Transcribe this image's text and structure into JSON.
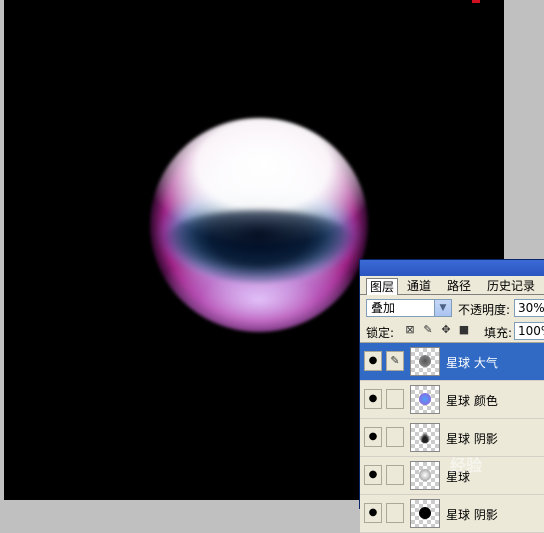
{
  "tabs": [
    {
      "label": "图层",
      "active": true
    },
    {
      "label": "通道",
      "active": false
    },
    {
      "label": "路径",
      "active": false
    },
    {
      "label": "历史记录",
      "active": false
    }
  ],
  "blend_mode": "叠加",
  "opacity_label": "不透明度:",
  "opacity_value": "30%",
  "lock_label": "锁定:",
  "fill_label": "填充:",
  "fill_value": "100%",
  "layers": [
    {
      "name": "星球 大气",
      "selected": true,
      "thumb_icon": "dark-sphere"
    },
    {
      "name": "星球 颜色",
      "selected": false,
      "thumb_icon": "blue-sphere"
    },
    {
      "name": "星球 阴影",
      "selected": false,
      "thumb_icon": "shadow-crescent"
    },
    {
      "name": "星球",
      "selected": false,
      "thumb_icon": "sphere"
    },
    {
      "name": "星球 阴影",
      "selected": false,
      "thumb_icon": "black-sphere"
    }
  ],
  "watermark": "经验",
  "colors": {
    "canvas": "#000000",
    "selection": "#316ac5",
    "panel": "#ece9d8"
  }
}
